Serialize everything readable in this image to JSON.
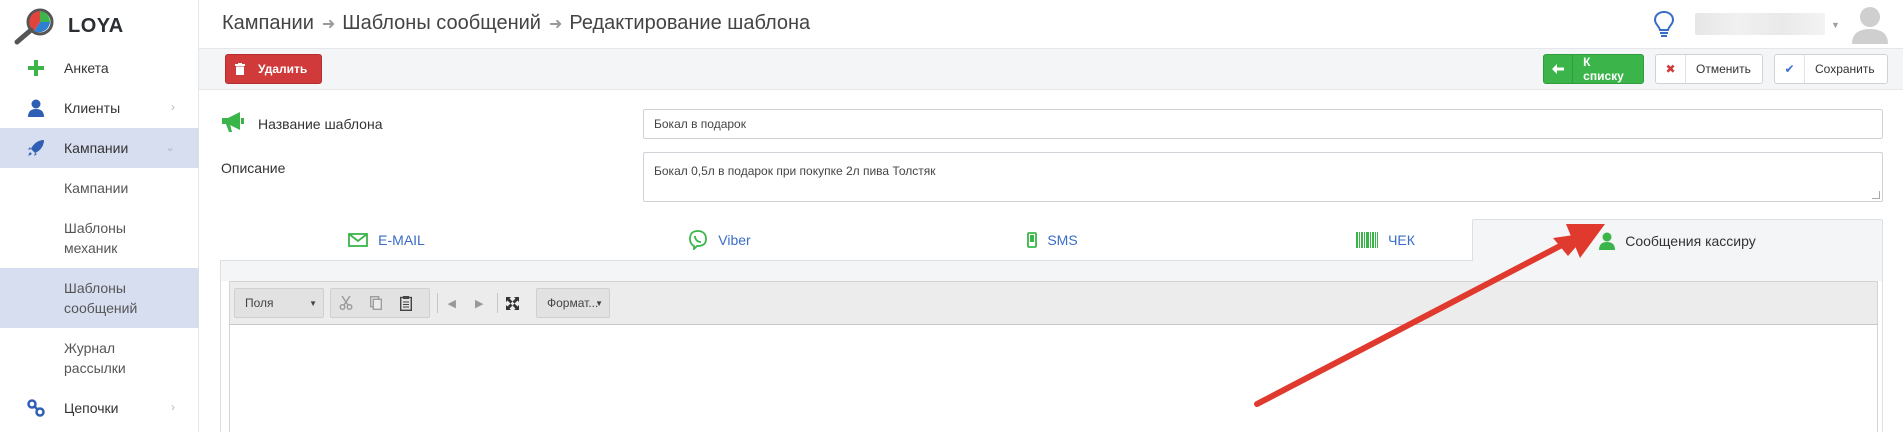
{
  "app": {
    "logo_text": "LOYA"
  },
  "sidebar": {
    "items": [
      {
        "label": "Анкета"
      },
      {
        "label": "Клиенты"
      },
      {
        "label": "Кампании"
      },
      {
        "label": "Цепочки"
      }
    ],
    "sub_items": [
      {
        "label": "Кампании"
      },
      {
        "label": "Шаблоны механик"
      },
      {
        "label": "Шаблоны сообщений"
      },
      {
        "label": "Журнал рассылки"
      }
    ]
  },
  "breadcrumb": {
    "items": [
      "Кампании",
      "Шаблоны сообщений",
      "Редактирование шаблона"
    ]
  },
  "actions": {
    "delete_label": "Удалить",
    "back_label": "К списку",
    "cancel_label": "Отменить",
    "save_label": "Сохранить"
  },
  "form": {
    "name_label": "Название шаблона",
    "name_value": "Бокал в подарок",
    "desc_label": "Описание",
    "desc_value": "Бокал 0,5л в подарок при покупке 2л пива Толстяк"
  },
  "tabs": [
    {
      "label": "E-MAIL",
      "icon": "envelope-icon"
    },
    {
      "label": "Viber",
      "icon": "viber-icon"
    },
    {
      "label": "SMS",
      "icon": "phone-icon"
    },
    {
      "label": "ЧЕК",
      "icon": "barcode-icon"
    },
    {
      "label": "Сообщения кассиру",
      "icon": "user-icon",
      "active": true
    }
  ],
  "editor": {
    "fields_label": "Поля",
    "format_label": "Формат..."
  },
  "colors": {
    "accent_green": "#3bb54a",
    "danger_red": "#d13a3a",
    "link_blue": "#3a6cc7",
    "active_nav": "#d7def0",
    "annotation_red": "#e03a2f"
  }
}
